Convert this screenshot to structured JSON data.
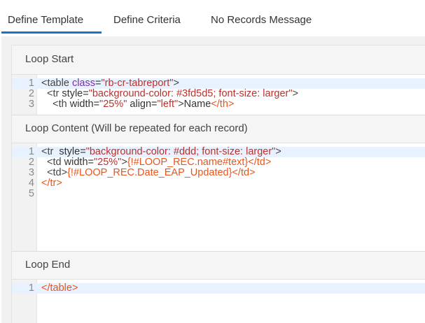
{
  "tabs": [
    {
      "label": "Define Template",
      "active": true
    },
    {
      "label": "Define Criteria",
      "active": false
    },
    {
      "label": "No Records Message",
      "active": false
    }
  ],
  "colors": {
    "accent": "#1a73c8",
    "tag": "#444444",
    "attribute": "#7a2ea6",
    "string": "#b8322d",
    "closing_tag": "#e8551e"
  },
  "sections": {
    "loop_start": {
      "title": "Loop Start",
      "lines": [
        {
          "n": "1",
          "tokens": [
            [
              "tg",
              "<table "
            ],
            [
              "at",
              "class"
            ],
            [
              "pl",
              "="
            ],
            [
              "st",
              "\"rb-cr-tabreport\""
            ],
            [
              "tg",
              ">"
            ]
          ]
        },
        {
          "n": "2",
          "tokens": [
            [
              "tg",
              "  <tr "
            ],
            [
              "pl",
              "style="
            ],
            [
              "st",
              "\"background-color: #3fd5d5; font-size: larger\""
            ],
            [
              "tg",
              ">"
            ]
          ]
        },
        {
          "n": "3",
          "tokens": [
            [
              "tg",
              "    <th "
            ],
            [
              "pl",
              "width="
            ],
            [
              "st",
              "\"25%\""
            ],
            [
              "pl",
              " align="
            ],
            [
              "st",
              "\"left\""
            ],
            [
              "tg",
              ">"
            ],
            [
              "pl",
              "Name"
            ],
            [
              "cl",
              "</th>"
            ]
          ]
        }
      ]
    },
    "loop_content": {
      "title": "Loop Content (Will be repeated for each record)",
      "lines": [
        {
          "n": "1",
          "tokens": [
            [
              "tg",
              "<tr  "
            ],
            [
              "pl",
              "style="
            ],
            [
              "st",
              "\"background-color: #ddd; font-size: larger\""
            ],
            [
              "tg",
              ">"
            ]
          ]
        },
        {
          "n": "2",
          "tokens": [
            [
              "tg",
              "  <td "
            ],
            [
              "pl",
              "width="
            ],
            [
              "st",
              "\"25%\""
            ],
            [
              "tg",
              ">"
            ],
            [
              "cl",
              "{!#LOOP_REC.name#text}"
            ],
            [
              "cl",
              "</td>"
            ]
          ]
        },
        {
          "n": "3",
          "tokens": [
            [
              "tg",
              "  <td>"
            ],
            [
              "cl",
              "{!#LOOP_REC.Date_EAP_Updated}"
            ],
            [
              "cl",
              "</td>"
            ]
          ]
        },
        {
          "n": "4",
          "tokens": [
            [
              "cl",
              "</tr>"
            ]
          ]
        },
        {
          "n": "5",
          "tokens": []
        }
      ]
    },
    "loop_end": {
      "title": "Loop End",
      "lines": [
        {
          "n": "1",
          "tokens": [
            [
              "cl",
              "</table>"
            ]
          ]
        }
      ]
    }
  }
}
